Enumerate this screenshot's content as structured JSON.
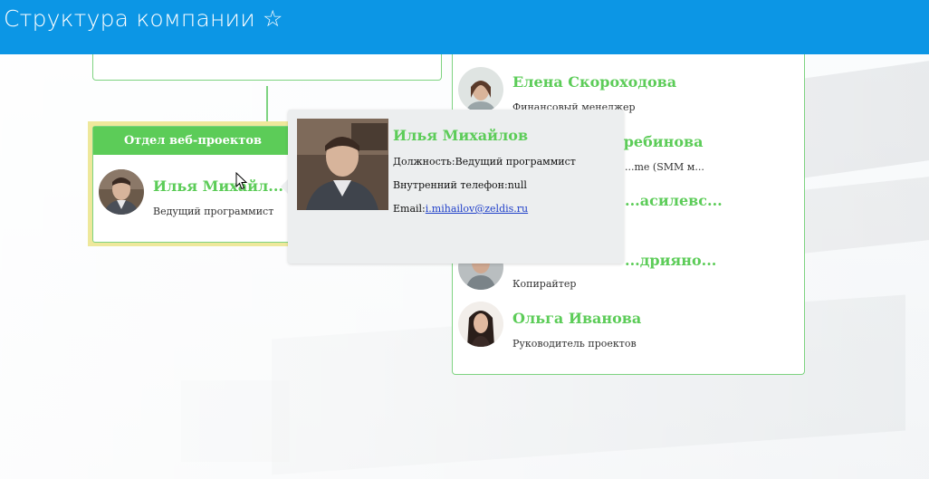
{
  "header": {
    "title": "Структура компании ☆"
  },
  "department": {
    "title": "Отдел веб-проектов",
    "employee": {
      "name": "Илья Михайл...",
      "role": "Ведущий программист"
    }
  },
  "right_list": [
    {
      "name": "Елена Скороходова",
      "role": "Финансовый менеджер"
    },
    {
      "name": "...ребинова",
      "role": "...me (SMM м..."
    },
    {
      "name": "...асилевс...",
      "role": ""
    },
    {
      "name": "...дрияно...",
      "role": "Копирайтер"
    },
    {
      "name": "Ольга Иванова",
      "role": "Руководитель проектов"
    }
  ],
  "tooltip": {
    "name": "Илья Михайлов",
    "position_label": "Должность:",
    "position_value": "Ведущий программист",
    "phone_label": "Внутренний телефон:",
    "phone_value": "null",
    "email_label": "Email:",
    "email_value": "i.mihailov@zeldis.ru"
  },
  "colors": {
    "header": "#0c96e5",
    "accent_green": "#5ccc58",
    "highlight": "#eee89b"
  },
  "icons": {
    "favorite": "star-outline-icon",
    "cursor": "mouse-pointer-icon"
  }
}
